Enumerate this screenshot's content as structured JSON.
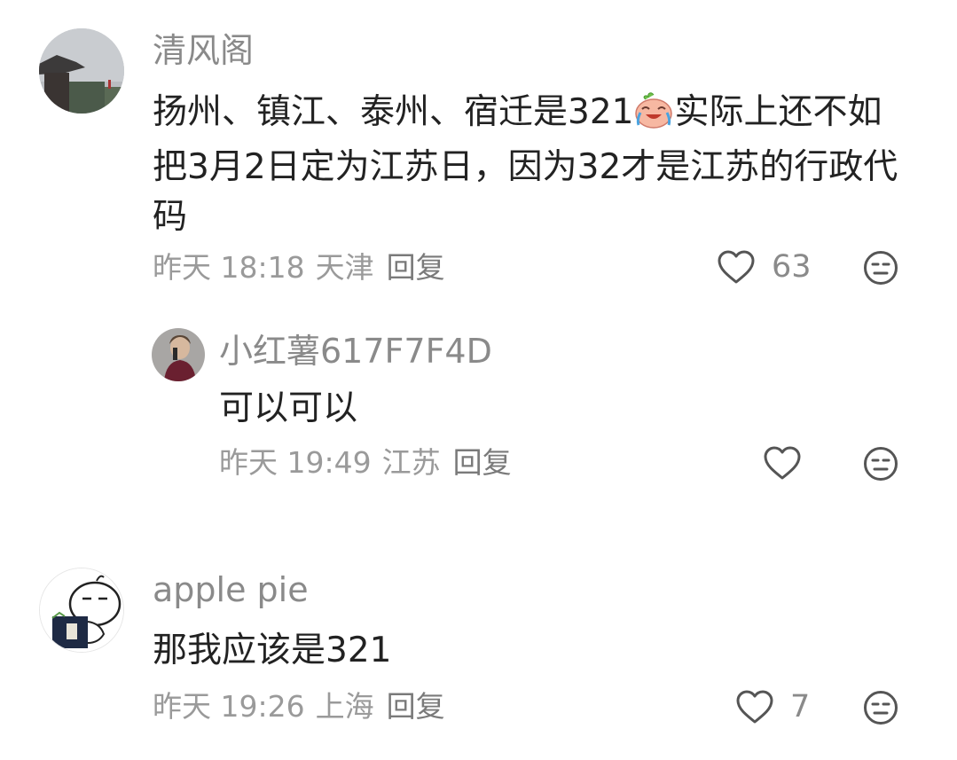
{
  "comments": [
    {
      "username": "清风阁",
      "text_before_emoji": "扬州、镇江、泰州、宿迁是321",
      "emoji": "crying-laughing-peach-emoji",
      "text_after_emoji": "实际上还不如把3月2日定为江苏日，因为32才是江苏的行政代码",
      "time": "昨天 18:18",
      "location": "天津",
      "reply_label": "回复",
      "like_count": "63"
    },
    {
      "username": "小红薯617F7F4D",
      "text": "可以可以",
      "time": "昨天 19:49",
      "location": "江苏",
      "reply_label": "回复"
    },
    {
      "username": "apple pie",
      "text": "那我应该是321",
      "time": "昨天 19:26",
      "location": "上海",
      "reply_label": "回复",
      "like_count": "7"
    }
  ],
  "colors": {
    "username": "#8a8a8a",
    "body_text": "#222222",
    "meta_text": "#9a9a9a",
    "icon_stroke": "#555555"
  }
}
